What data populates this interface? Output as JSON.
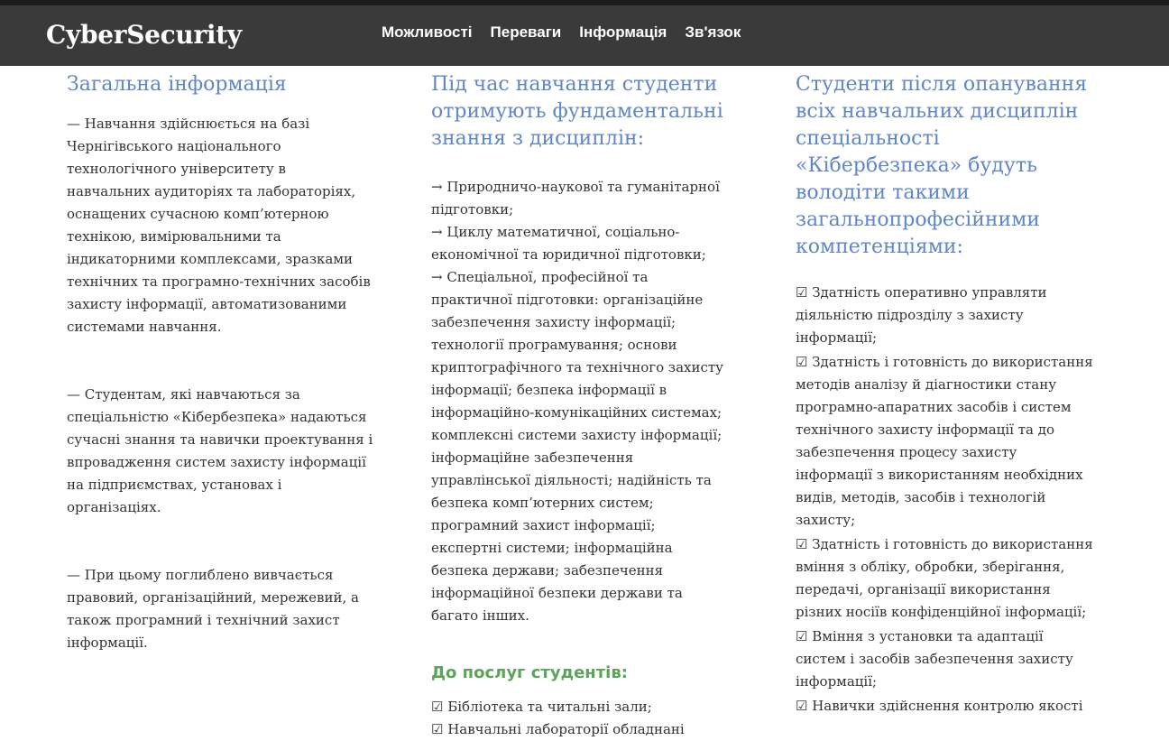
{
  "navbar": {
    "brand": "CyberSecurity",
    "menu": [
      "Можливості",
      "Переваги",
      "Інформація",
      "Зв'язок"
    ]
  },
  "colors": {
    "navbar_bg": "#3a3a3a",
    "heading": "#5f86c6",
    "services_heading": "#5aa55a",
    "text": "#333333"
  },
  "column1": {
    "title": "Загальна інформація",
    "paragraphs": [
      "— Навчання здійснюється на базі Чернігівського національного технологічного університету в навчальних аудиторіях та лабораторіях, оснащених сучасною комп’ютерною технікою, вимірювальними та індикаторними комплексами, зразками технічних та програмно-технічних засобів захисту інформації, автоматизованими системами навчання.",
      "— Студентам, які навчаються за спеціальністю «Кібербезпека» надаються сучасні знання та навички проектування і впровадження систем захисту інформації на підприємствах, установах і організаціях.",
      "— При цьому поглиблено вивчається правовий, організаційний, мережевий, а також програмний і технічний захист інформації."
    ]
  },
  "column2": {
    "title": "Під час навчання студенти отримують фундаментальні знання з дисциплін:",
    "items": [
      "→ Природничо-наукової та гуманітарної підготовки;",
      "→ Циклу математичної, соціально-економічної та юридичної підготовки;",
      "→ Спеціальної, професійної та практичної підготовки: організаційне забезпечення захисту інформації; технології програмування; основи криптографічного та технічного захисту інформації; безпека інформації в інформаційно-комунікаційних системах; комплексні системи захисту інформації; інформаційне забезпечення управлінської діяльності; надійність та безпека комп’ютерних систем; програмний захист інформації; експертні системи; інформаційна безпека держави; забезпечення інформаційної безпеки держави та багато інших."
    ],
    "services_title": "До послуг студентів:",
    "services": [
      "☑ Бібліотека та читальні зали;",
      "☑ Навчальні лабораторії обладнані"
    ]
  },
  "column3": {
    "title": "Студенти після опанування всіх навчальних дисциплін спеціальності «Кібербезпека» будуть володіти такими загальнопрофесійними компетенціями:",
    "items": [
      "☑ Здатність оперативно управляти діяльністю підрозділу з захисту інформації;",
      "☑ Здатність і готовність до використання методів аналізу й діагностики стану програмно-апаратних засобів і систем технічного захисту інформації та до забезпечення процесу захисту інформації з використанням необхідних видів, методів, засобів і технологій захисту;",
      "☑ Здатність і готовність до використання вміння з обліку, обробки, зберігання, передачі, організації використання різних носіїв конфіденційної інформації;",
      "☑ Вміння з установки та адаптації систем і засобів забезпечення захисту інформації;",
      "☑ Навички здійснення контролю якості"
    ]
  }
}
